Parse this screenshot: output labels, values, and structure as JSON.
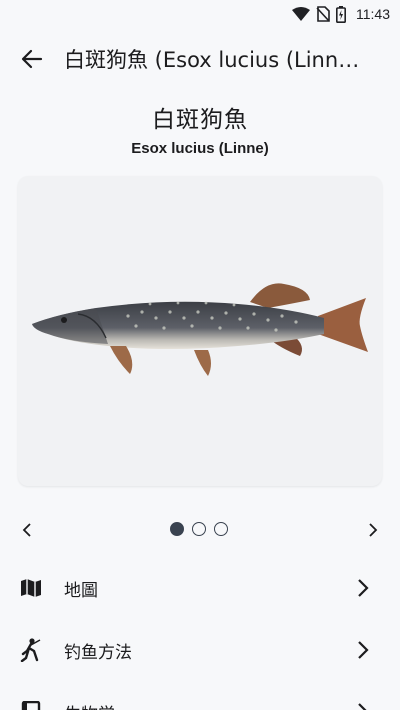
{
  "status_bar": {
    "time": "11:43"
  },
  "app_bar": {
    "title": "白斑狗魚 (Esox lucius (Linne))"
  },
  "species": {
    "name_zh": "白斑狗魚",
    "name_latin": "Esox lucius (Linne)"
  },
  "carousel": {
    "total": 3,
    "active_index": 0
  },
  "menu": {
    "items": [
      {
        "label": "地圖",
        "icon": "map-icon"
      },
      {
        "label": "钓鱼方法",
        "icon": "fishing-person-icon"
      },
      {
        "label": "生物学",
        "icon": "book-icon"
      }
    ]
  },
  "colors": {
    "background": "#f7f8fa",
    "card": "#f1f2f4",
    "dot": "#3a4350",
    "text": "#1c1c1e"
  }
}
